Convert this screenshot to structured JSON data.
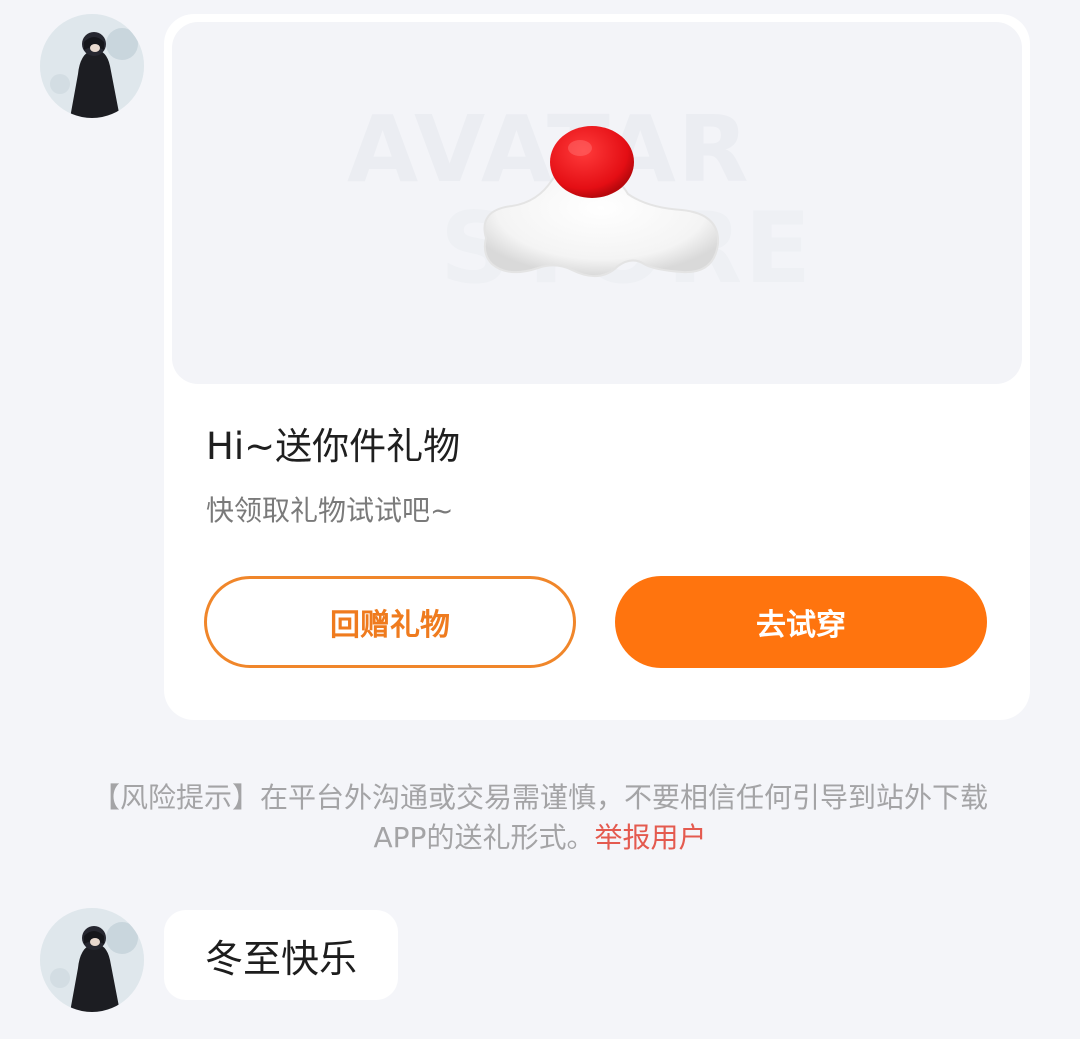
{
  "messages": [
    {
      "type": "gift_card",
      "sender_avatar": "user-avatar",
      "banner_watermark": [
        "AVATAR",
        "STORE"
      ],
      "gift_icon": "santa-hat-icon",
      "title": "Hi~送你件礼物",
      "subtitle": "快领取礼物试试吧~",
      "buttons": {
        "return_gift": "回赠礼物",
        "try_on": "去试穿"
      }
    },
    {
      "type": "text",
      "sender_avatar": "user-avatar",
      "text": "冬至快乐"
    }
  ],
  "risk_notice": {
    "text": "【风险提示】在平台外沟通或交易需谨慎，不要相信任何引导到站外下载APP的送礼形式。",
    "report_link": "举报用户"
  },
  "colors": {
    "background": "#f4f5f9",
    "accent_orange": "#ff740e",
    "report_red": "#e45a4f"
  }
}
